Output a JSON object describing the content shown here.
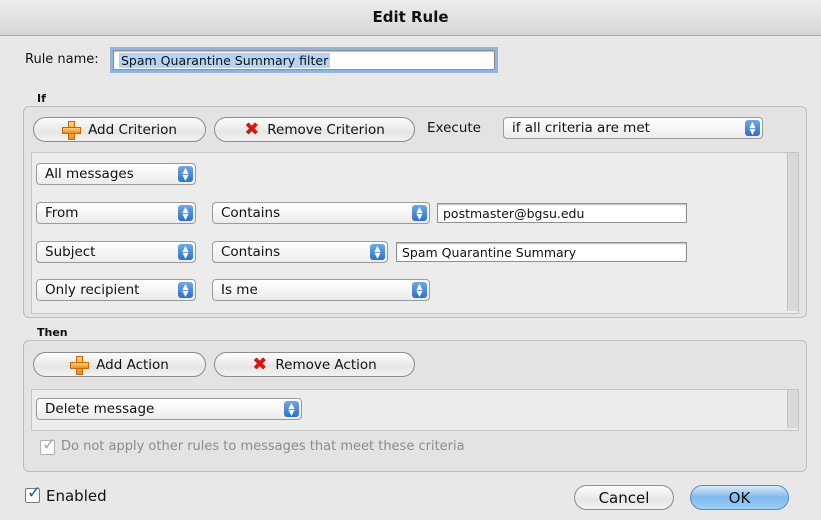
{
  "window": {
    "title": "Edit Rule"
  },
  "rule": {
    "name_label": "Rule name:",
    "name_value": "Spam Quarantine Summary filter"
  },
  "if_section": {
    "heading": "If",
    "add_label": "Add Criterion",
    "remove_label": "Remove Criterion",
    "execute_label": "Execute",
    "execute_value": "if all criteria are met",
    "criteria": [
      {
        "field": "All messages"
      },
      {
        "field": "From",
        "operator": "Contains",
        "value": "postmaster@bgsu.edu"
      },
      {
        "field": "Subject",
        "operator": "Contains",
        "value": "Spam Quarantine Summary"
      },
      {
        "field": "Only recipient",
        "operator": "Is me"
      }
    ]
  },
  "then_section": {
    "heading": "Then",
    "add_label": "Add Action",
    "remove_label": "Remove Action",
    "action": "Delete message",
    "stop_label": "Do not apply other rules to messages that meet these criteria",
    "stop_checked": true
  },
  "footer": {
    "enabled_label": "Enabled",
    "enabled_checked": true,
    "cancel_label": "Cancel",
    "ok_label": "OK"
  },
  "colors": {
    "accent": "#2f6fc8",
    "default_button": "#7fb9ec",
    "remove_icon": "#d8150a",
    "add_icon": "#f08a1a"
  },
  "icons": {
    "add": "plus-icon",
    "remove": "x-icon",
    "popup": "updown-arrows-icon",
    "check": "checkmark-icon"
  }
}
